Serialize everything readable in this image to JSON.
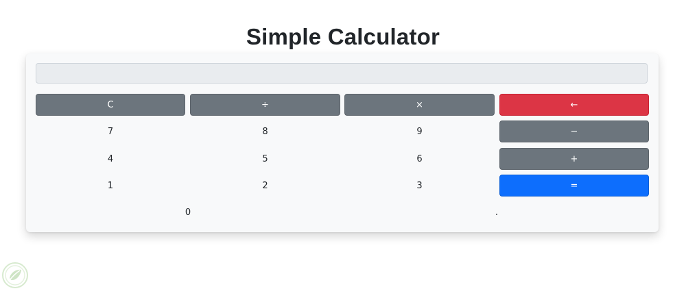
{
  "header": {
    "title": "Simple Calculator"
  },
  "display": {
    "value": ""
  },
  "buttons": {
    "clear": "C",
    "divide": "÷",
    "multiply": "×",
    "backspace": "←",
    "seven": "7",
    "eight": "8",
    "nine": "9",
    "subtract": "−",
    "four": "4",
    "five": "5",
    "six": "6",
    "add": "+",
    "one": "1",
    "two": "2",
    "three": "3",
    "equals": "=",
    "zero": "0",
    "decimal": "."
  },
  "colors": {
    "secondary": "#6c757d",
    "danger": "#dc3545",
    "primary": "#0d6efd",
    "panel": "#f8f9fa",
    "display": "#e9ecef"
  },
  "icons": {
    "watermark": "leaf-logo-icon"
  }
}
